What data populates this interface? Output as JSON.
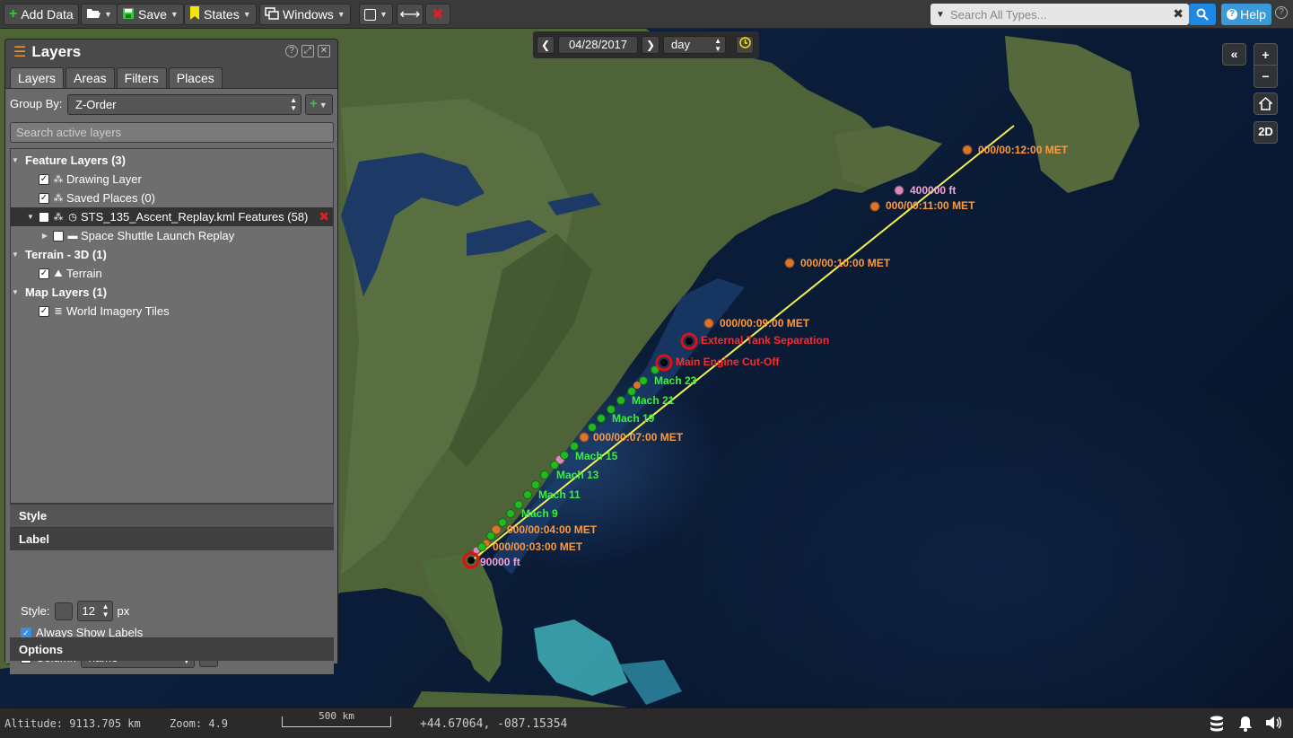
{
  "toolbar": {
    "add_data": "Add Data",
    "save": "Save",
    "states": "States",
    "windows": "Windows",
    "search_placeholder": "Search All Types...",
    "help": "Help"
  },
  "timebar": {
    "date": "04/28/2017",
    "interval": "day"
  },
  "nav": {
    "collapse": "«",
    "zoom_in": "+",
    "zoom_out": "−",
    "home": "⌂",
    "mode": "2D"
  },
  "panel": {
    "title": "Layers",
    "tabs": [
      "Layers",
      "Areas",
      "Filters",
      "Places"
    ],
    "group_by_label": "Group By:",
    "group_by_value": "Z-Order",
    "search_placeholder": "Search active layers",
    "tree": {
      "feature_layers": "Feature Layers (3)",
      "drawing_layer": "Drawing Layer",
      "saved_places": "Saved Places (0)",
      "sts_features": "STS_135_Ascent_Replay.kml Features (58)",
      "shuttle_replay": "Space Shuttle Launch Replay",
      "terrain_group": "Terrain - 3D (1)",
      "terrain": "Terrain",
      "map_layers": "Map Layers (1)",
      "world_imagery": "World Imagery Tiles"
    },
    "sections": {
      "style": "Style",
      "label": "Label",
      "options": "Options"
    },
    "label_settings": {
      "style_label": "Style:",
      "size": "12",
      "unit": "px",
      "always_show": "Always Show Labels",
      "column_label": "Column",
      "column_value": "name"
    }
  },
  "map_labels": {
    "met12": "000/00:12:00 MET",
    "ft400k": "400000 ft",
    "met11": "000/00:11:00 MET",
    "met10": "000/00:10:00 MET",
    "met9": "000/00:09:00 MET",
    "ext_tank": "External Tank Separation",
    "meco": "Main Engine Cut-Off",
    "mach23": "Mach 23",
    "mach21": "Mach 21",
    "mach19": "Mach 19",
    "met7": "000/00:07:00 MET",
    "mach15": "Mach 15",
    "mach13": "Mach 13",
    "mach11": "Mach 11",
    "mach9": "Mach 9",
    "met4": "000/00:04:00 MET",
    "met3": "000/00:03:00 MET",
    "ft90k": "90000 ft"
  },
  "status": {
    "altitude": "Altitude: 9113.705 km",
    "zoom": "Zoom: 4.9",
    "scale": "500 km",
    "coords": "+44.67064, -087.15354"
  },
  "colors": {
    "track": "#f2f24a",
    "met_marker": "#d9752a",
    "met_text": "#ff9a3c",
    "mach_marker": "#22b822",
    "mach_text": "#3cf03c",
    "event_text": "#ff2a2a",
    "altitude_marker": "#d98ab8",
    "altitude_text": "#f2a6d6"
  }
}
